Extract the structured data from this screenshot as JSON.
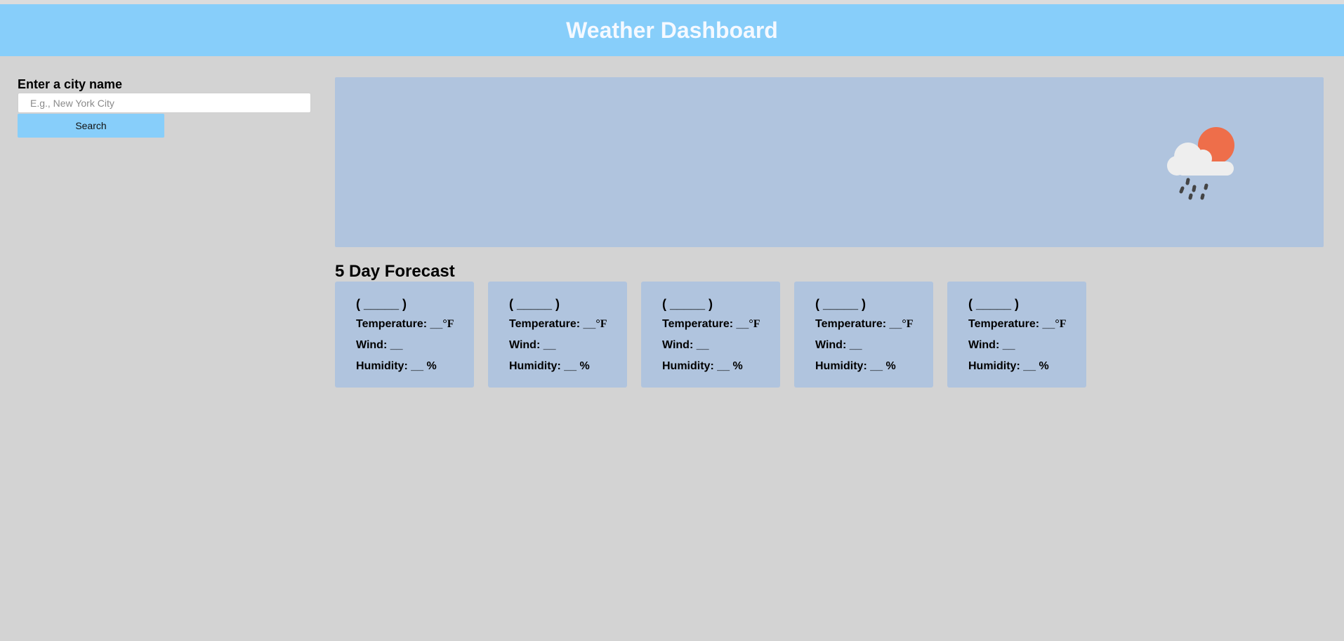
{
  "header": {
    "title": "Weather Dashboard"
  },
  "search": {
    "label": "Enter a city name",
    "placeholder": "E.g., New York City",
    "value": "",
    "button_label": "Search"
  },
  "current": {
    "icon": "cloud-rain-sun-icon",
    "colors": {
      "sun": "#ee6e4a",
      "cloud": "#eeeeee",
      "rain": "#444444"
    }
  },
  "forecast": {
    "title": "5 Day Forecast",
    "cards": [
      {
        "date": "( _____ )",
        "temp_label": "Temperature: __",
        "temp_unit": "°F",
        "wind": "Wind: __",
        "humidity": "Humidity: __ %"
      },
      {
        "date": "( _____ )",
        "temp_label": "Temperature: __",
        "temp_unit": "°F",
        "wind": "Wind: __",
        "humidity": "Humidity: __ %"
      },
      {
        "date": "( _____ )",
        "temp_label": "Temperature: __",
        "temp_unit": "°F",
        "wind": "Wind: __",
        "humidity": "Humidity: __ %"
      },
      {
        "date": "( _____ )",
        "temp_label": "Temperature: __",
        "temp_unit": "°F",
        "wind": "Wind: __",
        "humidity": "Humidity: __ %"
      },
      {
        "date": "( _____ )",
        "temp_label": "Temperature: __",
        "temp_unit": "°F",
        "wind": "Wind: __",
        "humidity": "Humidity: __ %"
      }
    ]
  },
  "colors": {
    "header_bg": "#87cefa",
    "page_bg": "#d3d3d3",
    "panel_bg": "#b0c4de",
    "button_bg": "#87cefa"
  }
}
